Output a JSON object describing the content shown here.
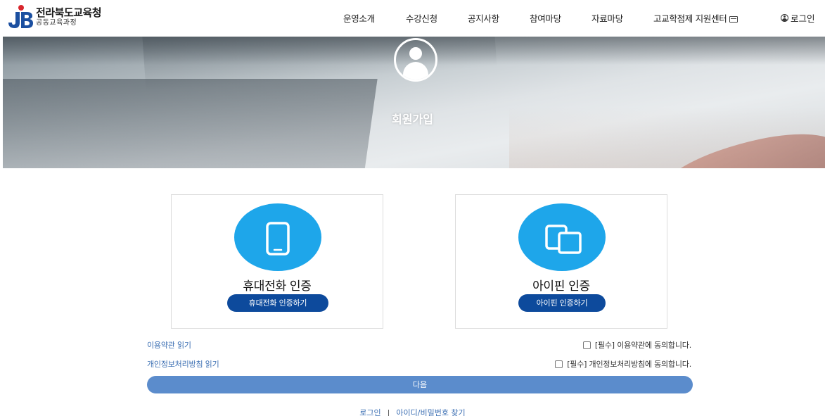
{
  "header": {
    "logo_title": "전라북도교육청",
    "logo_sub": "공동교육과정",
    "nav": [
      "운영소개",
      "수강신청",
      "공지사항",
      "참여마당",
      "자료마당",
      "고교학점제 지원센터"
    ],
    "login": "로그인"
  },
  "banner": {
    "title": "회원가입"
  },
  "auth": {
    "phone": {
      "title": "휴대전화 인증",
      "button": "휴대전화 인증하기",
      "icon": "mobile-phone-icon"
    },
    "ipin": {
      "title": "아이핀 인증",
      "button": "아이핀 인증하기",
      "icon": "ipin-devices-icon"
    }
  },
  "terms": {
    "read_terms": "이용약관 읽기",
    "read_privacy": "개인정보처리방침 읽기",
    "agree_terms": "[필수] 이용약관에 동의합니다.",
    "agree_privacy": "[필수] 개인정보처리방침에 동의합니다."
  },
  "next_button": "다음",
  "footer_links": {
    "login": "로그인",
    "separator": "|",
    "find": "아이디/비밀번호 찾기"
  },
  "colors": {
    "primary_blue": "#0d4a9c",
    "icon_circle": "#1ea6ea",
    "next_button": "#5b8ccc",
    "link": "#3c6fb3"
  }
}
